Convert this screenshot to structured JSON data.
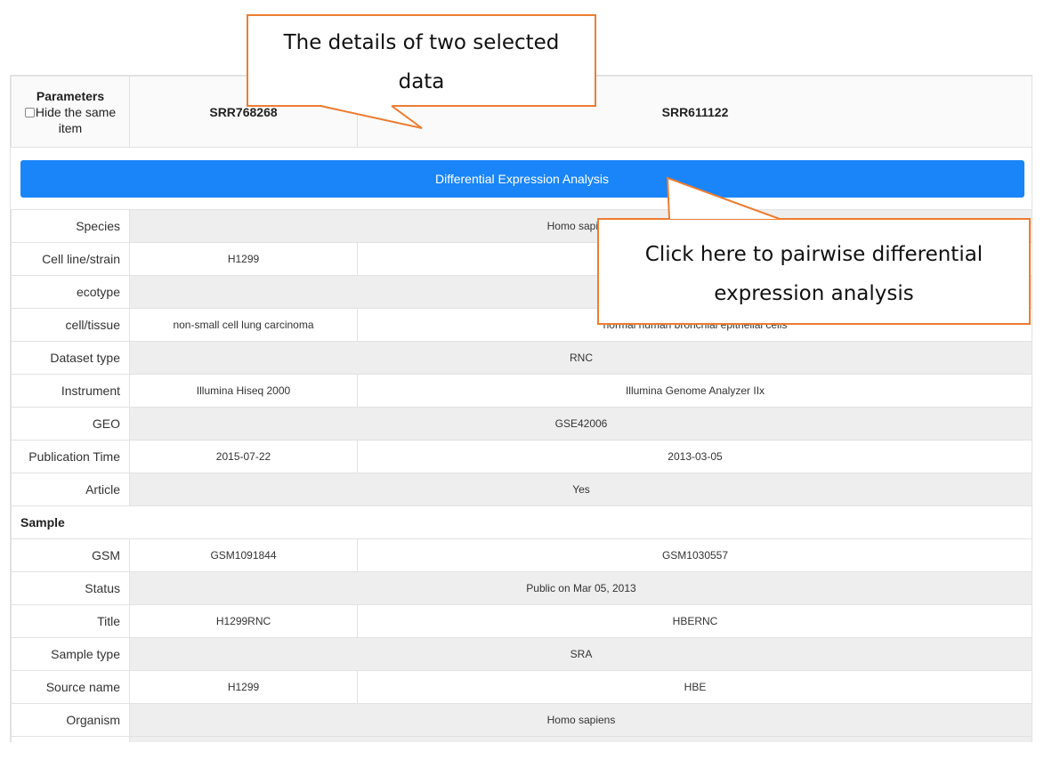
{
  "header": {
    "parameters_label": "Parameters",
    "hide_same_label": "Hide the same item",
    "sample_a": "SRR768268",
    "sample_b": "SRR611122"
  },
  "actions": {
    "differential_expression_label": "Differential Expression Analysis"
  },
  "rows": [
    {
      "label": "Species",
      "merged": true,
      "value": "Homo sapiens"
    },
    {
      "label": "Cell line/strain",
      "merged": false,
      "a": "H1299",
      "b": ""
    },
    {
      "label": "ecotype",
      "merged": true,
      "value": ""
    },
    {
      "label": "cell/tissue",
      "merged": false,
      "a": "non-small cell lung carcinoma",
      "b": "normal human bronchial epithelial cells"
    },
    {
      "label": "Dataset type",
      "merged": true,
      "value": "RNC"
    },
    {
      "label": "Instrument",
      "merged": false,
      "a": "Illumina Hiseq 2000",
      "b": "Illumina Genome Analyzer IIx"
    },
    {
      "label": "GEO",
      "merged": true,
      "value": "GSE42006"
    },
    {
      "label": "Publication Time",
      "merged": false,
      "a": "2015-07-22",
      "b": "2013-03-05"
    },
    {
      "label": "Article",
      "merged": true,
      "value": "Yes"
    }
  ],
  "sample_section": {
    "title": "Sample",
    "rows": [
      {
        "label": "GSM",
        "merged": false,
        "a": "GSM1091844",
        "b": "GSM1030557"
      },
      {
        "label": "Status",
        "merged": true,
        "value": "Public on Mar 05, 2013"
      },
      {
        "label": "Title",
        "merged": false,
        "a": "H1299RNC",
        "b": "HBERNC"
      },
      {
        "label": "Sample type",
        "merged": true,
        "value": "SRA"
      },
      {
        "label": "Source name",
        "merged": false,
        "a": "H1299",
        "b": "HBE"
      },
      {
        "label": "Organism",
        "merged": true,
        "value": "Homo sapiens"
      },
      {
        "label": "",
        "merged": true,
        "value": ""
      }
    ]
  },
  "callouts": {
    "top": [
      "The details of two selected",
      "data"
    ],
    "right": [
      "Click here to pairwise differential",
      "expression analysis"
    ]
  },
  "colors": {
    "accent_button": "#1a85f9",
    "callout_border": "#ed7d31",
    "shaded_row": "#eeeeee"
  },
  "icons": {
    "hide_same_checkbox": "checkbox-unchecked"
  }
}
